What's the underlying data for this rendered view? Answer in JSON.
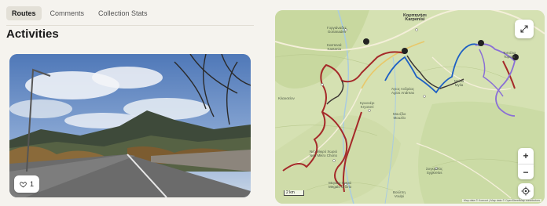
{
  "tabs": [
    {
      "label": "Routes",
      "active": true
    },
    {
      "label": "Comments",
      "active": false
    },
    {
      "label": "Collection Stats",
      "active": false
    }
  ],
  "heading": "Activities",
  "photo_card": {
    "like_count": "1"
  },
  "map": {
    "scale_label": "2 km",
    "attribution": "Map data © Komoot | Map data © OpenStreetMap contributors",
    "labels": {
      "kariotisa": "Καρπηνήσι",
      "kariotisa2": "Karpenisi",
      "gorianades": "Γοργιάναδες",
      "gorianades2": "Gorianades",
      "kastania": "Καστανιά",
      "kastania2": "Kastania",
      "agios": "Άγιος Ανδρέας",
      "agios2": "Agios Andreas",
      "mylia": "Μυλιά",
      "mylia2": "Mylia",
      "mouzilo": "Μουζίλο",
      "mouzilo2": "Mouzilo",
      "neo": "Νέο Μικρό Χωριό",
      "neo2": "Neo Mikro Chorio",
      "megalo": "Μεγάλο Χωριό",
      "megalo2": "Megalo Chorio",
      "sygkrelos": "Συγκρελός",
      "sygkrelos2": "Sygkrelos",
      "klauseion": "Κλαυσείον",
      "kryoneri": "Κρυονέρι",
      "kryoneri2": "Kryoneri",
      "topolia": "Τοπόλια",
      "topolia2": "Topolia",
      "voulpi": "Βούλπη",
      "voulpi2": "Voulpi"
    }
  },
  "colors": {
    "accent": "#e3e0d7",
    "route_red": "#a52a2a",
    "route_blue": "#1c5fc4",
    "route_purple": "#8a6fd6",
    "route_dark": "#3c3633"
  },
  "icons": {
    "like": "heart-icon",
    "expand": "expand-icon",
    "locate": "locate-icon"
  }
}
